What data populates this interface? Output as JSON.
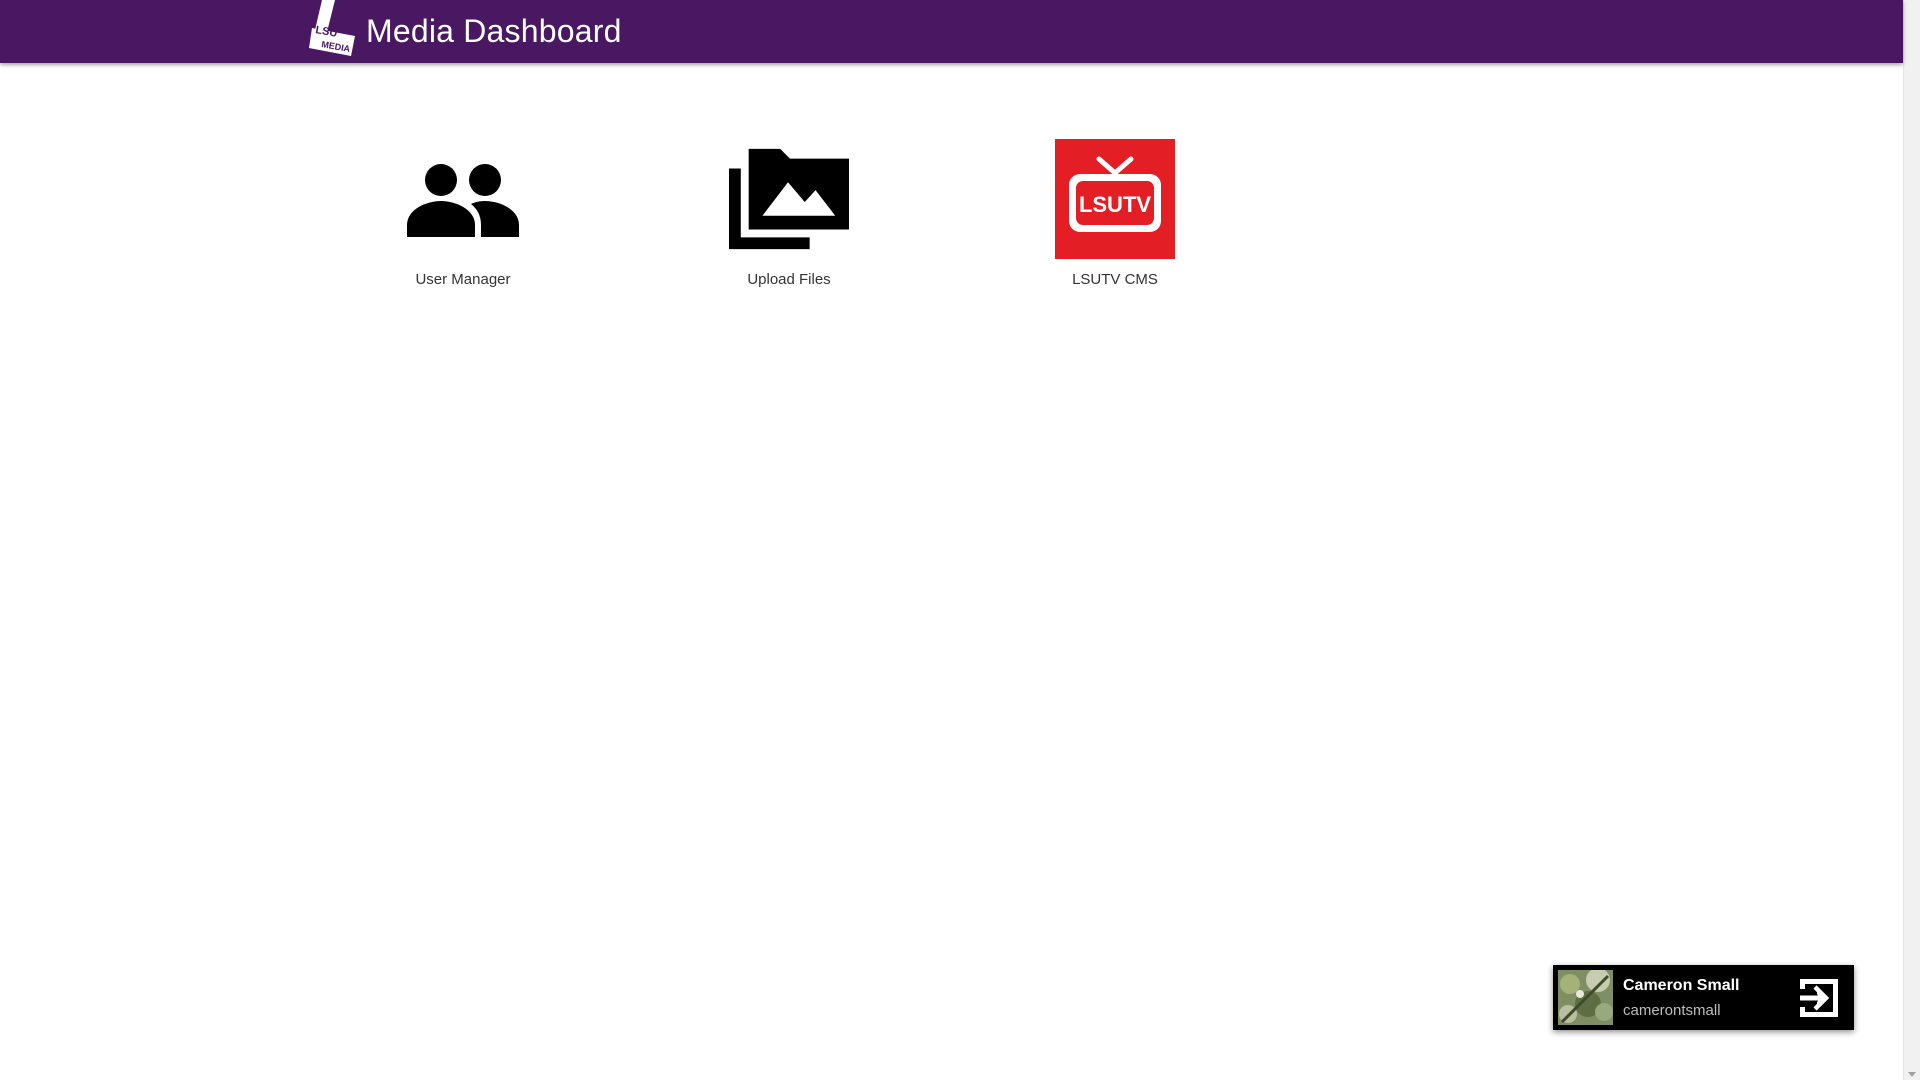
{
  "header": {
    "title": "Media Dashboard",
    "logo_text_top": "LSU",
    "logo_text_bottom": "MEDIA",
    "background_color": "#4a1863"
  },
  "tiles": [
    {
      "label": "User Manager",
      "icon": "people-icon"
    },
    {
      "label": "Upload Files",
      "icon": "photo-library-icon"
    },
    {
      "label": "LSUTV CMS",
      "icon": "lsutv-logo",
      "logo_text": "LSUTV",
      "accent_color": "#e31e24"
    }
  ],
  "user": {
    "name": "Cameron Small",
    "username": "camerontsmall",
    "logout_icon": "logout-icon"
  }
}
